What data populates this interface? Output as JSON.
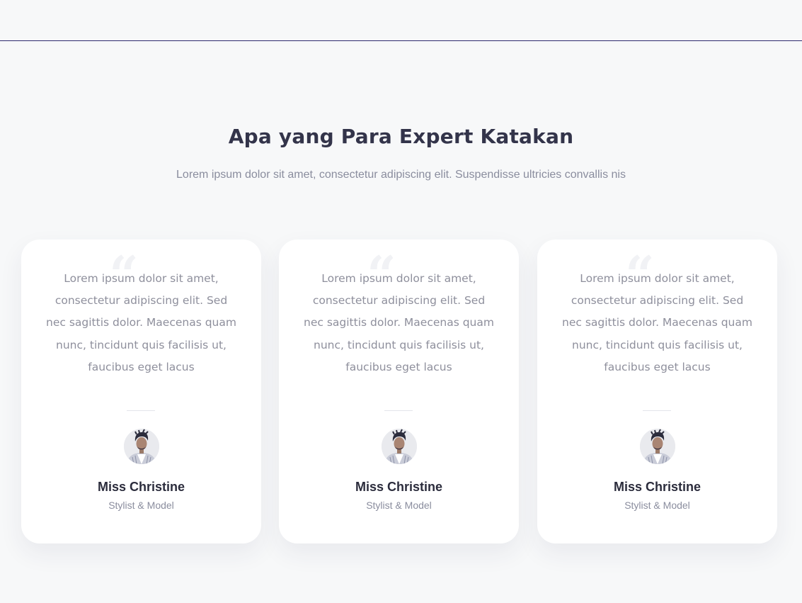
{
  "section": {
    "title": "Apa yang Para Expert Katakan",
    "subtitle": "Lorem ipsum dolor sit amet, consectetur adipiscing elit. Suspendisse ultricies convallis nis"
  },
  "testimonials": [
    {
      "quote_icon": "quote-icon",
      "text": "Lorem ipsum dolor sit amet, consectetur adipiscing elit. Sed nec sagittis dolor. Maecenas quam nunc, tincidunt quis facilisis ut, faucibus eget lacus",
      "name": "Miss Christine",
      "role": "Stylist & Model"
    },
    {
      "quote_icon": "quote-icon",
      "text": "Lorem ipsum dolor sit amet, consectetur adipiscing elit. Sed nec sagittis dolor. Maecenas quam nunc, tincidunt quis facilisis ut, faucibus eget lacus",
      "name": "Miss Christine",
      "role": "Stylist & Model"
    },
    {
      "quote_icon": "quote-icon",
      "text": "Lorem ipsum dolor sit amet, consectetur adipiscing elit. Sed nec sagittis dolor. Maecenas quam nunc, tincidunt quis facilisis ut, faucibus eget lacus",
      "name": "Miss Christine",
      "role": "Stylist & Model"
    }
  ],
  "colors": {
    "page_background": "#f7f8f9",
    "header_border": "#2d2a6e",
    "title": "#33344a",
    "muted_text": "#8a8d9e",
    "card_background": "#ffffff"
  }
}
